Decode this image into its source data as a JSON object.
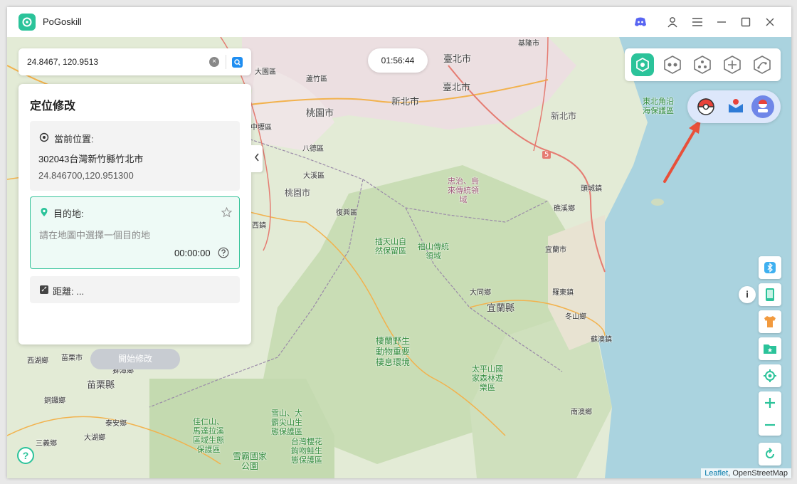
{
  "app": {
    "title": "PoGoskill"
  },
  "titlebar_icons": [
    "discord-icon",
    "user-icon",
    "menu-icon",
    "minimize-icon",
    "maximize-icon",
    "close-icon"
  ],
  "search": {
    "value": "24.8467, 120.9513"
  },
  "timer": {
    "value": "01:56:44"
  },
  "panel": {
    "title": "定位修改",
    "current": {
      "label": "當前位置:",
      "address": "302043台灣新竹縣竹北市",
      "coords": "24.846700,120.951300"
    },
    "destination": {
      "label": "目的地:",
      "placeholder": "請在地圖中選擇一個目的地",
      "time": "00:00:00"
    },
    "distance": {
      "label": "距離: ..."
    },
    "start_button": "開始修改"
  },
  "map_labels": {
    "keelung": "基隆市",
    "taipei": "臺北市",
    "newtaipei": "新北市",
    "newtaipei2": "新北市",
    "taoyuan": "桃園市",
    "taoyuan2": "桃園市",
    "dayuan": "大園區",
    "luzhu": "蘆竹區",
    "zhongli": "中壢區",
    "bade": "八德區",
    "daxi": "大溪區",
    "fuxing": "復興區",
    "yilan_county": "宜蘭縣",
    "yilan_city": "宜蘭市",
    "toucheng": "頭城鎮",
    "jiaoxi": "礁溪鄉",
    "luodong": "羅東鎮",
    "datong": "大同鄉",
    "dongshan": "冬山鄉",
    "suao": "蘇澳鎮",
    "nanao": "南澳鄉",
    "miaoli": "苗栗縣",
    "miaoli_city": "苗栗市",
    "xihu": "西湖鄉",
    "shitan": "獅潭鄉",
    "tongluo": "銅鑼鄉",
    "taian": "泰安鄉",
    "sanyi": "三義鄉",
    "dahu": "大湖鄉",
    "xiangshan": "西鎮",
    "road5": "5",
    "northeast_coast": "東北角沿\n海保護區",
    "lalashan": "插天山自\n然保留區",
    "fushan": "福山傳統\n領域",
    "zhongzhi": "忠治、烏\n來傳統領\n域",
    "qiyan": "棲蘭野生\n動物重要\n棲息環境",
    "taipingshan": "太平山國\n家森林遊\n樂區",
    "jiali": "佳仁山、\n馬達拉溪\n區域生態\n保護區",
    "xueshan": "雪山、大\n霸尖山生\n態保護區",
    "yingh": "台灣櫻花\n鉤吻鮭生\n態保護區",
    "shei": "雪霸國家\n公園"
  },
  "attribution": {
    "leaflet": "Leaflet",
    "osm": ", OpenStreetMap"
  },
  "colors": {
    "accent": "#2bc39a",
    "brand_blue": "#1f8ef1",
    "start_disabled": "#c8ccd2"
  }
}
